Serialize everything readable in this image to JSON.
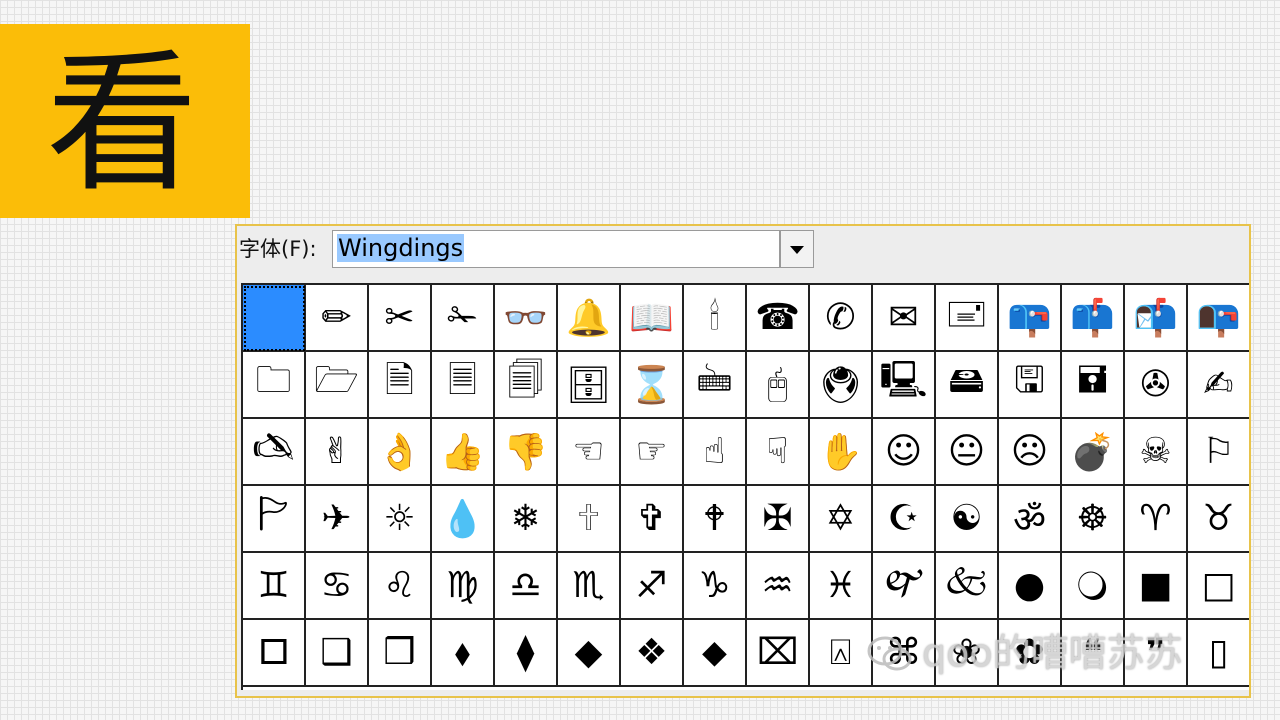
{
  "title": {
    "char": "看"
  },
  "font_dialog": {
    "label": "字体(F):",
    "font_value": "Wingdings",
    "symbols": [
      "",
      "✏",
      "✂",
      "✁",
      "👓",
      "🔔",
      "📖",
      "🕯",
      "☎",
      "✆",
      "✉",
      "🖃",
      "📪",
      "📫",
      "📬",
      "📭",
      "🗀",
      "🗁",
      "🗎",
      "🗏",
      "🗐",
      "🗄",
      "⌛",
      "🖮",
      "🖰",
      "🖲",
      "🖳",
      "🖴",
      "🖫",
      "🖬",
      "✇",
      "✍",
      "🖎",
      "✌",
      "👌",
      "👍",
      "👎",
      "☜",
      "☞",
      "☝",
      "☟",
      "✋",
      "☺",
      "😐",
      "☹",
      "💣",
      "☠",
      "⚐",
      "🏱",
      "✈",
      "☼",
      "💧",
      "❄",
      "🕆",
      "✞",
      "🕈",
      "✠",
      "✡",
      "☪",
      "☯",
      "ॐ",
      "☸",
      "♈",
      "♉",
      "♊",
      "♋",
      "♌",
      "♍",
      "♎",
      "♏",
      "♐",
      "♑",
      "♒",
      "♓",
      "🙰",
      "🙵",
      "●",
      "🔾",
      "■",
      "□",
      "🞐",
      "❑",
      "❒",
      "⬧",
      "⧫",
      "◆",
      "❖",
      "⬥",
      "⌧",
      "⍓",
      "⌘",
      "❀",
      "✿",
      "❝",
      "❞",
      "▯"
    ]
  },
  "watermark": {
    "text": "qoo的嘈嘈苏苏"
  }
}
